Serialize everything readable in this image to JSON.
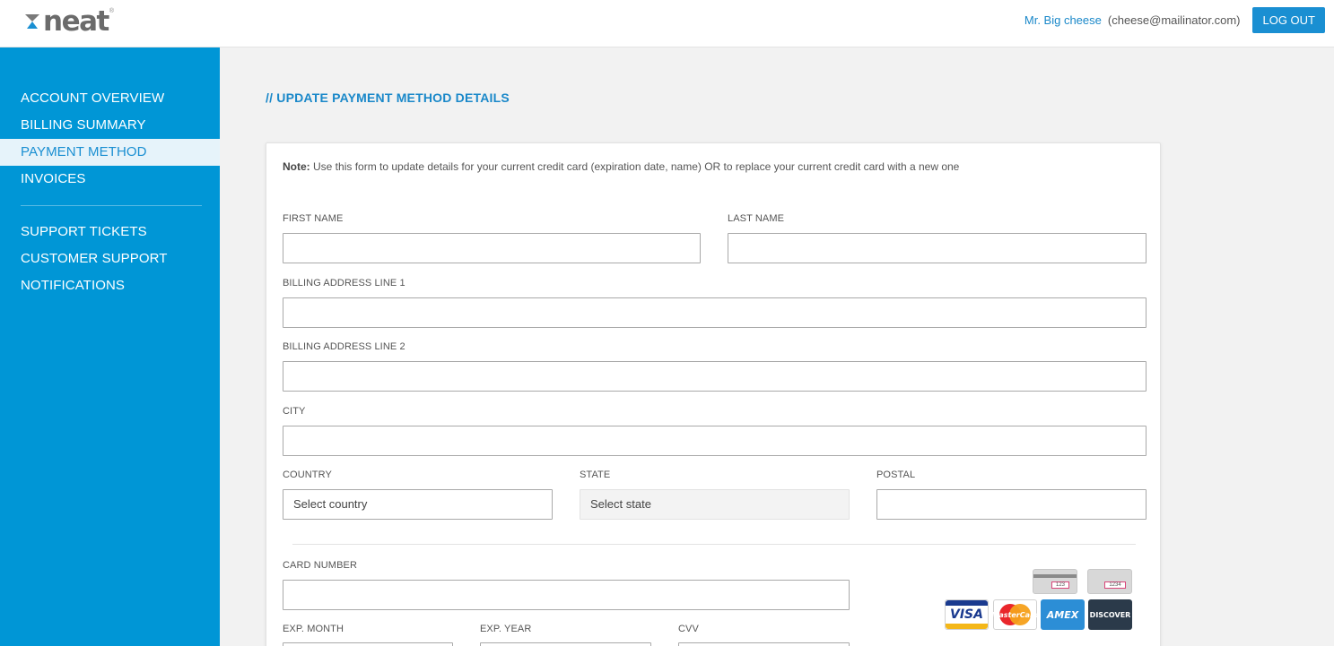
{
  "header": {
    "logo_text": "neat",
    "logo_tm": "®",
    "user_name": "Mr. Big cheese",
    "user_email": "(cheese@mailinator.com)",
    "logout_label": "LOG OUT"
  },
  "sidebar": {
    "items": [
      {
        "label": "ACCOUNT OVERVIEW",
        "active": false
      },
      {
        "label": "BILLING SUMMARY",
        "active": false
      },
      {
        "label": "PAYMENT METHOD",
        "active": true
      },
      {
        "label": "INVOICES",
        "active": false
      }
    ],
    "items2": [
      {
        "label": "SUPPORT TICKETS"
      },
      {
        "label": "CUSTOMER SUPPORT"
      },
      {
        "label": "NOTIFICATIONS"
      }
    ]
  },
  "main": {
    "title": "// UPDATE PAYMENT METHOD DETAILS",
    "note_label": "Note:",
    "note_text": " Use this form to update details for your current credit card (expiration date, name) OR to replace your current credit card with a new one",
    "form": {
      "first_name": {
        "label": "FIRST NAME",
        "value": ""
      },
      "last_name": {
        "label": "LAST NAME",
        "value": ""
      },
      "address1": {
        "label": "BILLING ADDRESS LINE 1",
        "value": ""
      },
      "address2": {
        "label": "BILLING ADDRESS LINE 2",
        "value": ""
      },
      "city": {
        "label": "CITY",
        "value": ""
      },
      "country": {
        "label": "COUNTRY",
        "value": "Select country"
      },
      "state": {
        "label": "STATE",
        "value": "Select state",
        "disabled": true
      },
      "postal": {
        "label": "POSTAL",
        "value": ""
      },
      "card_number": {
        "label": "CARD NUMBER",
        "value": ""
      },
      "exp_month": {
        "label": "EXP. MONTH",
        "value": ""
      },
      "exp_year": {
        "label": "EXP. YEAR",
        "value": ""
      },
      "cvv": {
        "label": "CVV",
        "value": ""
      }
    },
    "card_brands": [
      {
        "name": "VISA",
        "icon": "visa-icon"
      },
      {
        "name": "MasterCard",
        "icon": "mastercard-icon"
      },
      {
        "name": "AMEX",
        "icon": "amex-icon"
      },
      {
        "name": "DISCOVER",
        "icon": "discover-icon"
      }
    ],
    "cvv_examples": [
      "123",
      "1234"
    ]
  },
  "colors": {
    "brand_blue": "#0096d6",
    "accent_blue": "#1a88c9",
    "button_blue": "#1a8fd2"
  }
}
